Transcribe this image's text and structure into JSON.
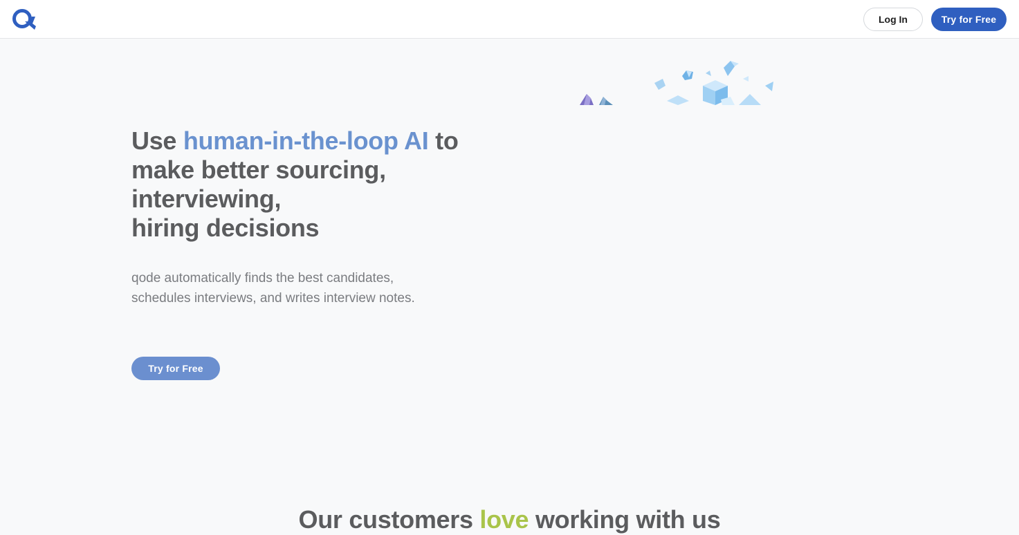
{
  "brand": {
    "logo_icon": "qode-logo-icon",
    "accent": "#2f5fc0"
  },
  "nav": {
    "login_label": "Log In",
    "try_label": "Try for Free"
  },
  "hero": {
    "headline_prefix": "Use ",
    "headline_accent": "human-in-the-loop AI",
    "headline_line1_suffix": " to",
    "headline_line2": "make better sourcing,",
    "headline_line3": "interviewing,",
    "headline_line4": "hiring decisions",
    "subtext_line1": "qode automatically finds the best candidates,",
    "subtext_line2": "schedules interviews, and writes interview notes.",
    "cta_label": "Try for Free",
    "art_icon": "geometric-shapes-illustration",
    "colors": {
      "headline": "#5b5c5e",
      "accent": "#6a92cf",
      "cta": "#6b8fcf"
    }
  },
  "customers": {
    "title_prefix": "Our customers ",
    "title_accent": "love",
    "title_suffix": " working with us",
    "accent_color": "#a9c44a"
  }
}
